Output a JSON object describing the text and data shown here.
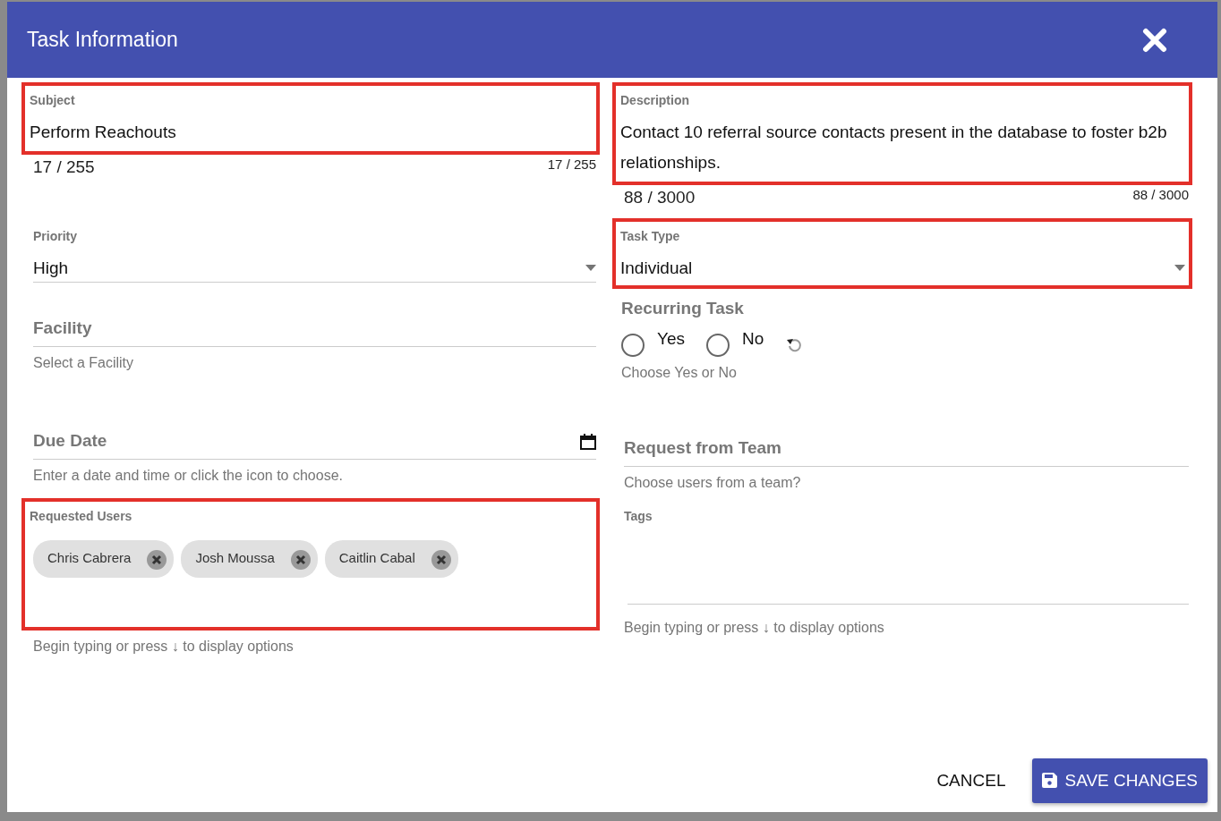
{
  "dialog": {
    "title": "Task Information"
  },
  "rows": [
    [
      {
        "kind": "text",
        "label": "Subject",
        "value": "Perform Reachouts",
        "counter_left": "17 / 255",
        "counter_right": "17 / 255",
        "highlighted": true
      },
      {
        "kind": "text",
        "label": "Description",
        "value": "Contact 10 referral source contacts present in the database to foster b2b relationships.",
        "counter_left": "88 / 3000",
        "counter_right": "88 / 3000",
        "highlighted": true
      }
    ],
    [
      {
        "kind": "select",
        "label": "Priority",
        "value": "High",
        "highlighted": false
      },
      {
        "kind": "select",
        "label": "Task Type",
        "value": "Individual",
        "highlighted": true
      }
    ],
    [
      {
        "kind": "input",
        "label": "Facility",
        "hint": "Select a Facility"
      },
      {
        "kind": "radio",
        "label": "Recurring Task",
        "options": [
          {
            "label": "Yes",
            "selected": false
          },
          {
            "label": "No",
            "selected": false
          }
        ],
        "hint": "Choose Yes or No"
      }
    ],
    [
      {
        "kind": "date",
        "label": "Due Date",
        "hint": "Enter a date and time or click the icon to choose."
      },
      {
        "kind": "input",
        "label": "Request from Team",
        "hint": "Choose users from a team?"
      }
    ],
    [
      {
        "kind": "chips",
        "label": "Requested Users",
        "chips": [
          "Chris Cabrera",
          "Josh Moussa",
          "Caitlin Cabal"
        ],
        "hint": "Begin typing or press ↓ to display options",
        "highlighted": true
      },
      {
        "kind": "chips",
        "label": "Tags",
        "hint": "Begin typing or press ↓ to display options",
        "highlighted": false
      }
    ]
  ],
  "buttons": {
    "cancel": "CANCEL",
    "save": "SAVE CHANGES"
  }
}
